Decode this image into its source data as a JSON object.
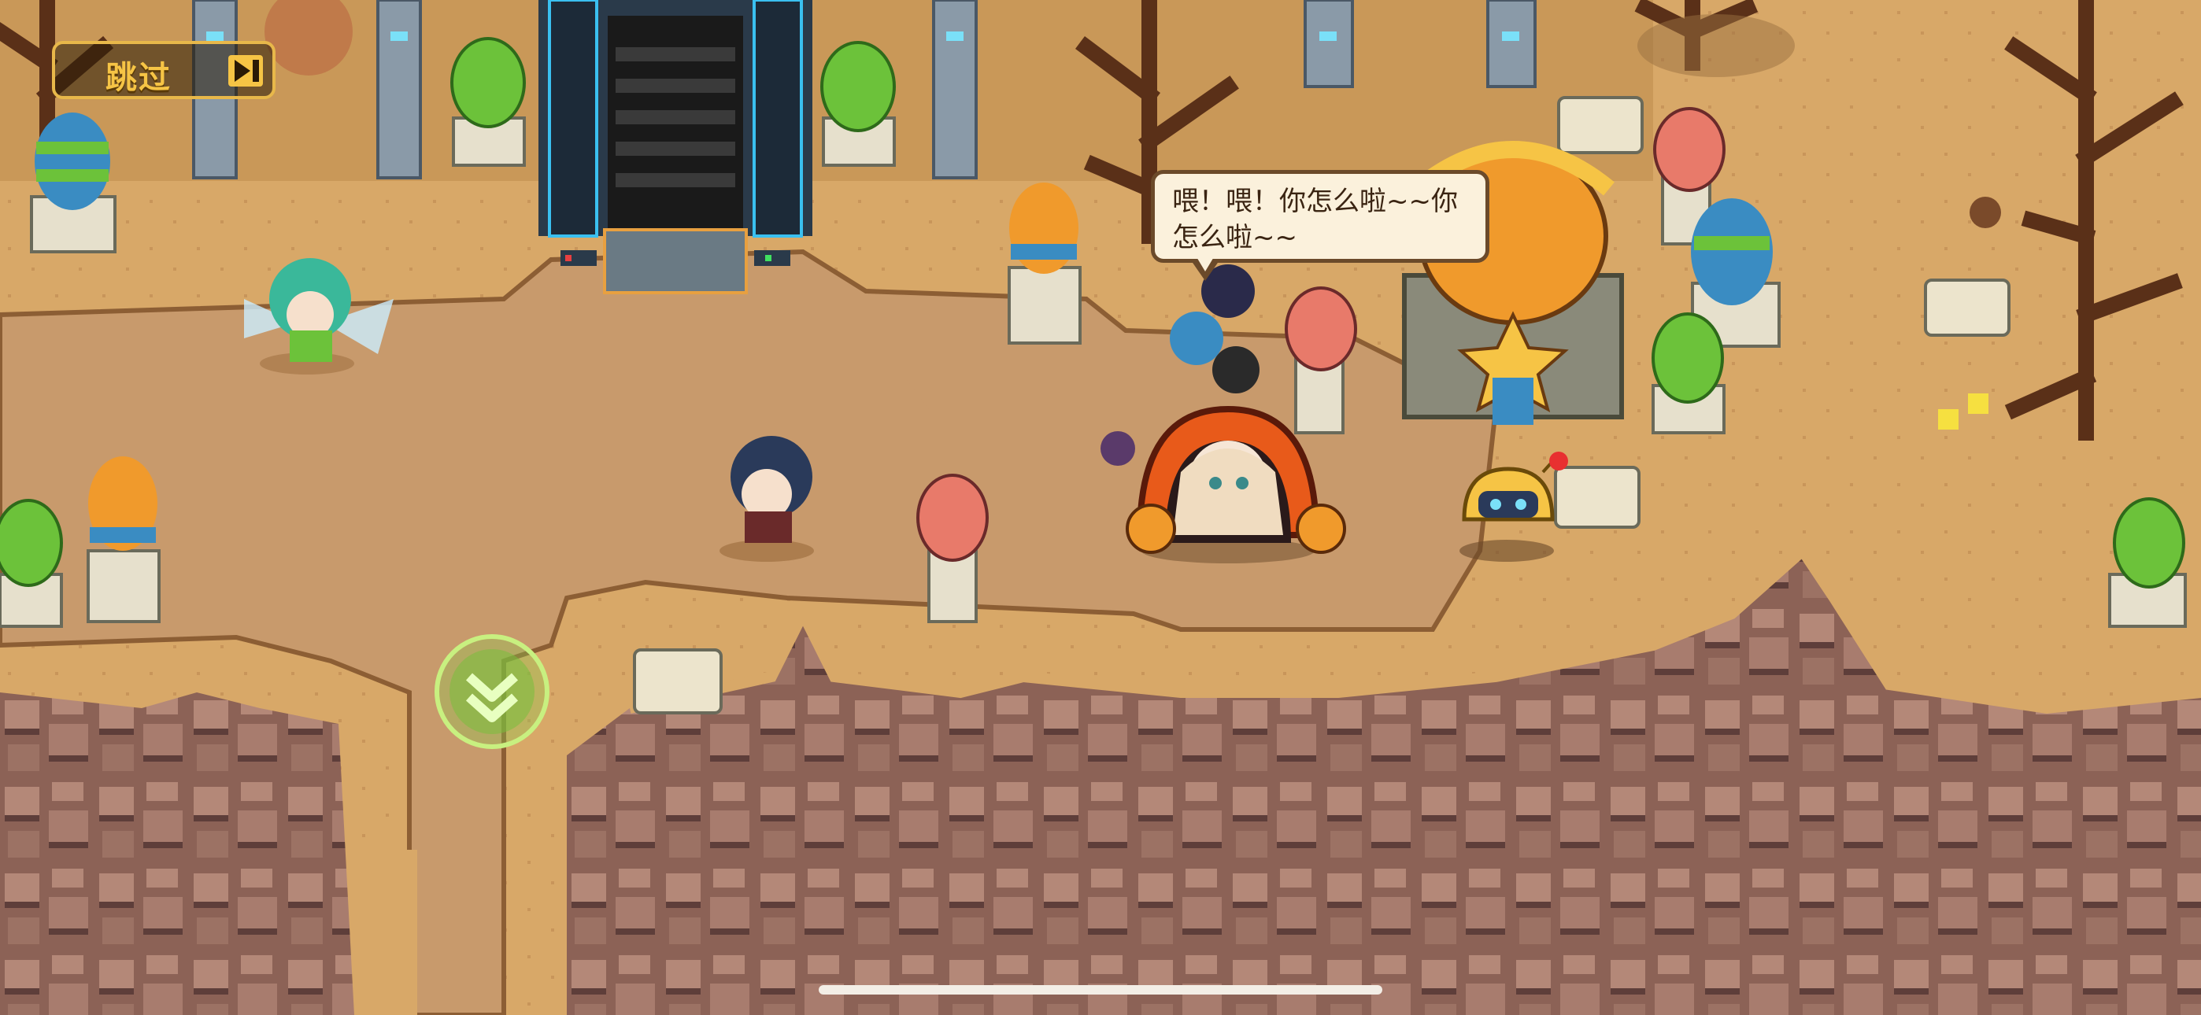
{
  "hud": {
    "skip_label": "跳过",
    "skip_icon": "skip-forward-icon",
    "descend_icon": "double-chevron-down-icon"
  },
  "dialog": {
    "line1": "喂！喂！你怎么啦~~你",
    "line2": "怎么啦~~"
  },
  "colors": {
    "ground": "#d8a868",
    "path": "#c89a6c",
    "cliff": "#9a6e60",
    "cliff_dark": "#5a3a3a",
    "accent_gold": "#f6c445",
    "egg_green": "#6cc23a",
    "egg_blue": "#3a8cc2",
    "egg_orange": "#f09a2c",
    "egg_red": "#e87a6a"
  }
}
